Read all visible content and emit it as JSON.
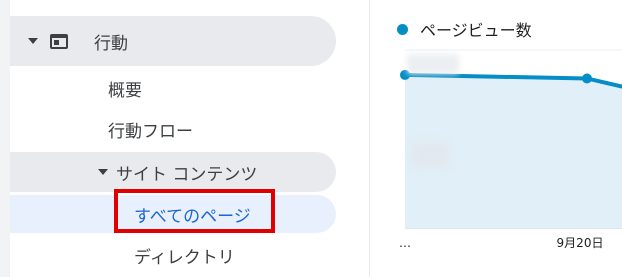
{
  "nav": {
    "section_label": "行動",
    "items": [
      {
        "label": "概要"
      },
      {
        "label": "行動フロー"
      }
    ],
    "subsection_label": "サイト コンテンツ",
    "active_item_label": "すべてのページ",
    "next_item_label": "ディレクトリ"
  },
  "chart": {
    "legend_label": "ページビュー数",
    "series_color": "#058dc7"
  },
  "chart_data": {
    "type": "area",
    "x": [
      "…",
      "",
      "9月20日",
      ""
    ],
    "series": [
      {
        "name": "ページビュー数",
        "values": [
          0.86,
          0.84,
          0.78
        ]
      }
    ],
    "x_tick_labels": [
      "…",
      "9月20日"
    ],
    "grid": true
  },
  "colors": {
    "accent": "#1967d2",
    "highlight_border": "#e00000",
    "line": "#058dc7"
  }
}
